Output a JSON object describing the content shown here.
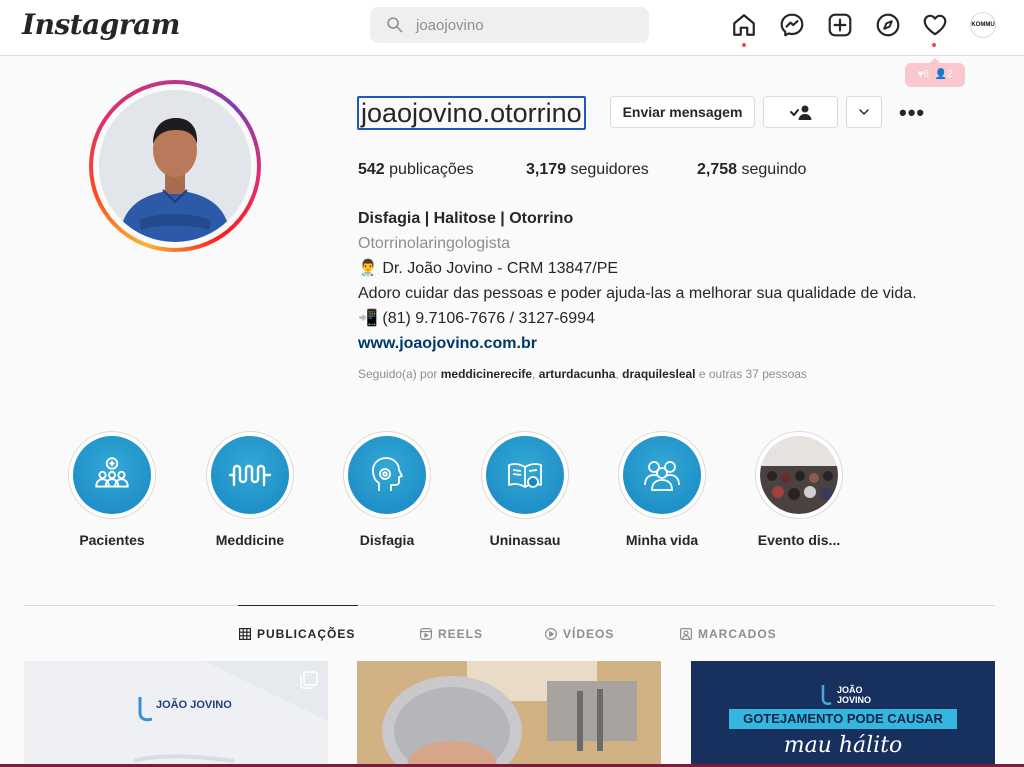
{
  "topbar": {
    "logo": "Instagram",
    "search_value": "joaojovino",
    "avatar_label": "KOMMU",
    "notifications": {
      "likes": "6",
      "follows": "2"
    }
  },
  "profile": {
    "username": "joaojovino.otorrino",
    "message_button": "Enviar mensagem",
    "stats": {
      "posts_count": "542",
      "posts_label": "publicações",
      "followers_count": "3,179",
      "followers_label": "seguidores",
      "following_count": "2,758",
      "following_label": "seguindo"
    },
    "bio": {
      "name": "Disfagia | Halitose | Otorrino",
      "category": "Otorrinolaringologista",
      "line1": "👨‍⚕️ Dr. João Jovino - CRM 13847/PE",
      "line2": "Adoro cuidar das pessoas e poder ajuda-las a melhorar sua qualidade de vida.",
      "line3": "📲 (81) 9.7106-7676 / 3127-6994",
      "website": "www.joaojovino.com.br"
    },
    "followed_by": {
      "prefix": "Seguido(a) por",
      "user1": "meddicinerecife",
      "user2": "arturdacunha",
      "user3": "draquilesleal",
      "suffix": "e outras 37 pessoas"
    }
  },
  "highlights": [
    {
      "label": "Pacientes",
      "icon": "patients-icon"
    },
    {
      "label": "Meddicine",
      "icon": "meddicine-logo-icon"
    },
    {
      "label": "Disfagia",
      "icon": "head-icon"
    },
    {
      "label": "Uninassau",
      "icon": "book-icon"
    },
    {
      "label": "Minha vida",
      "icon": "group-icon"
    },
    {
      "label": "Evento dis...",
      "icon": "event-photo"
    }
  ],
  "tabs": [
    {
      "label": "PUBLICAÇÕES",
      "icon": "grid-icon"
    },
    {
      "label": "REELS",
      "icon": "reels-icon"
    },
    {
      "label": "VÍDEOS",
      "icon": "video-icon"
    },
    {
      "label": "MARCADOS",
      "icon": "tagged-icon"
    }
  ],
  "posts": [
    {
      "brand": "JOÃO JOVINO"
    },
    {
      "brand": ""
    },
    {
      "brand": "JOÃO JOVINO",
      "headline": "GOTEJAMENTO PODE CAUSAR",
      "script": "mau hálito"
    }
  ],
  "colors": {
    "link": "#00376b",
    "highlight": "#1887c2",
    "notification": "#ed4956",
    "focus": "#1e56c4"
  }
}
